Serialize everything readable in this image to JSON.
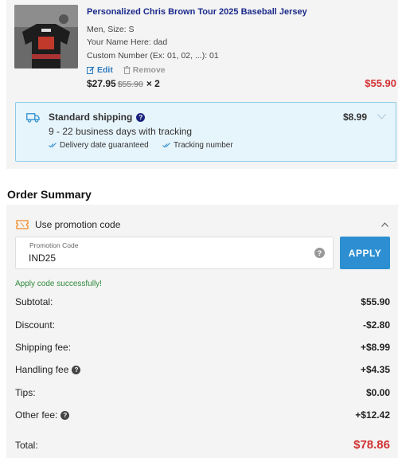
{
  "product": {
    "title": "Personalized Chris Brown Tour 2025 Baseball Jersey",
    "options": [
      "Men, Size: S",
      "Your Name Here: dad",
      "Custom Number (Ex: 01, 02, ...): 01"
    ],
    "edit_label": "Edit",
    "remove_label": "Remove",
    "price": "$27.95",
    "original_price": "$55.90",
    "quantity": "× 2",
    "line_total": "$55.90",
    "thumbnail_icon": "jersey-image"
  },
  "shipping": {
    "name": "Standard shipping",
    "help": "?",
    "days": "9 - 22 business days with tracking",
    "features": [
      "Delivery date guaranteed",
      "Tracking number"
    ],
    "price": "$8.99"
  },
  "summary": {
    "title": "Order Summary",
    "promo": {
      "label": "Use promotion code",
      "field_label": "Promotion Code",
      "value": "IND25",
      "help": "?",
      "apply_label": "APPLY",
      "success": "Apply code successfully!"
    },
    "rows": [
      {
        "label": "Subtotal:",
        "value": "$55.90"
      },
      {
        "label": "Discount:",
        "value": "-$2.80"
      },
      {
        "label": "Shipping fee:",
        "value": "+$8.99"
      },
      {
        "label": "Handling fee",
        "value": "+$4.35",
        "help": "?"
      },
      {
        "label": "Tips:",
        "value": "$0.00"
      },
      {
        "label": "Other fee:",
        "value": "+$12.42",
        "help": "?"
      }
    ],
    "total_label": "Total:",
    "total_value": "$78.86"
  },
  "colors": {
    "accent_blue": "#2d8fd1",
    "price_red": "#d23232",
    "title_navy": "#1b2a8a",
    "success_green": "#2e8b3a",
    "shipping_bg": "#e6f4fb"
  }
}
